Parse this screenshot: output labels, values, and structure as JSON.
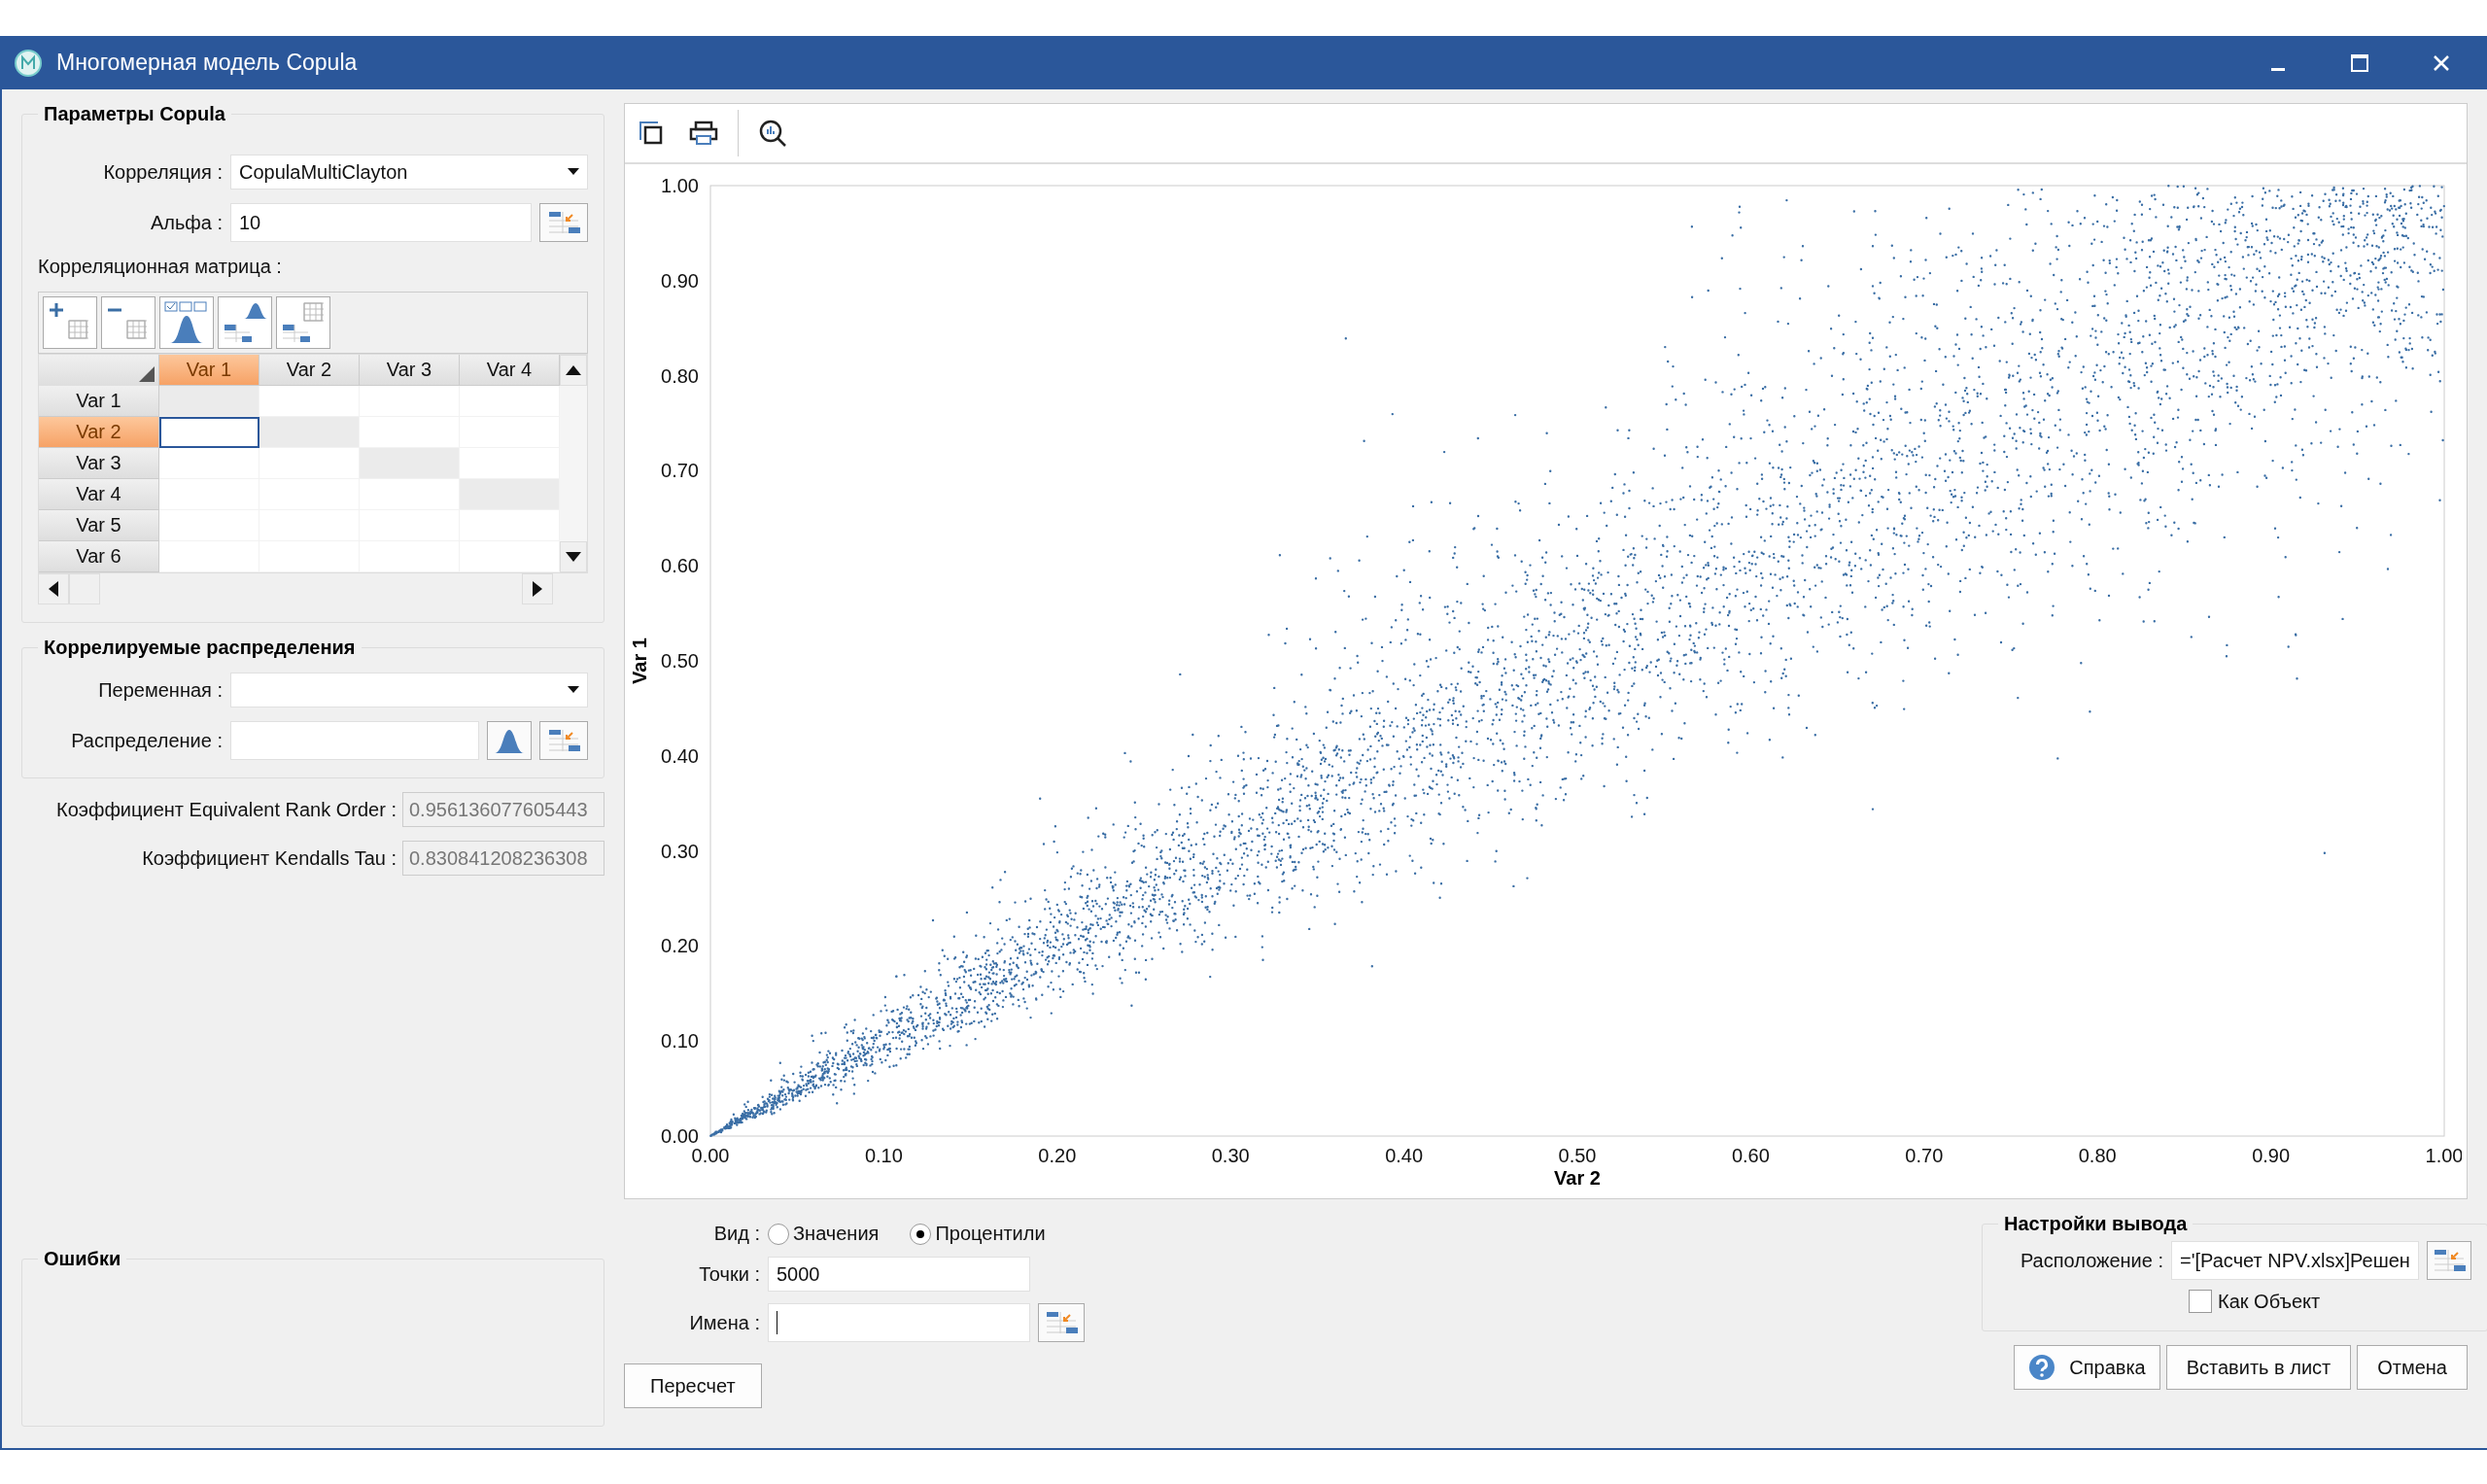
{
  "window": {
    "title": "Многомерная модель Copula"
  },
  "copula_params": {
    "title": "Параметры Copula",
    "correlation": {
      "label": "Корреляция :",
      "value": "CopulaMultiClayton"
    },
    "alpha": {
      "label": "Альфа :",
      "value": "10"
    },
    "matrix_label": "Корреляционная матрица :",
    "matrix": {
      "columns": [
        {
          "label": "Var 1",
          "selected": true
        },
        {
          "label": "Var 2",
          "selected": false
        },
        {
          "label": "Var 3",
          "selected": false
        },
        {
          "label": "Var 4",
          "selected": false
        }
      ],
      "rows": [
        {
          "label": "Var 1",
          "selected": false
        },
        {
          "label": "Var 2",
          "selected": true
        },
        {
          "label": "Var 3",
          "selected": false
        },
        {
          "label": "Var 4",
          "selected": false
        },
        {
          "label": "Var 5",
          "selected": false
        },
        {
          "label": "Var 6",
          "selected": false
        }
      ]
    }
  },
  "distributions": {
    "title": "Коррелируемые распределения",
    "variable": {
      "label": "Переменная :"
    },
    "distribution": {
      "label": "Распределение :"
    }
  },
  "coefficients": [
    {
      "label": "Коэффициент Equivalent Rank Order :",
      "value": "0.956136077605443"
    },
    {
      "label": "Коэффициент Kendalls Tau :",
      "value": "0.830841208236308"
    }
  ],
  "errors": {
    "title": "Ошибки"
  },
  "chart": {
    "chart_data": {
      "type": "scatter",
      "xlabel": "Var 2",
      "ylabel": "Var 1",
      "xlim": [
        0,
        1
      ],
      "ylim": [
        0,
        1
      ],
      "xticks": [
        {
          "value": 0,
          "label": "0.00"
        },
        {
          "value": 0.1,
          "label": "0.10"
        },
        {
          "value": 0.2,
          "label": "0.20"
        },
        {
          "value": 0.3,
          "label": "0.30"
        },
        {
          "value": 0.4,
          "label": "0.40"
        },
        {
          "value": 0.5,
          "label": "0.50"
        },
        {
          "value": 0.6,
          "label": "0.60"
        },
        {
          "value": 0.7,
          "label": "0.70"
        },
        {
          "value": 0.8,
          "label": "0.80"
        },
        {
          "value": 0.9,
          "label": "0.90"
        },
        {
          "value": 1,
          "label": "1.00"
        }
      ],
      "yticks": [
        {
          "value": 0,
          "label": "0.00"
        },
        {
          "value": 0.1,
          "label": "0.10"
        },
        {
          "value": 0.2,
          "label": "0.20"
        },
        {
          "value": 0.3,
          "label": "0.30"
        },
        {
          "value": 0.4,
          "label": "0.40"
        },
        {
          "value": 0.5,
          "label": "0.50"
        },
        {
          "value": 0.6,
          "label": "0.60"
        },
        {
          "value": 0.7,
          "label": "0.70"
        },
        {
          "value": 0.8,
          "label": "0.80"
        },
        {
          "value": 0.9,
          "label": "0.90"
        },
        {
          "value": 1,
          "label": "1.00"
        }
      ]
    }
  },
  "view": {
    "label": "Вид :",
    "options": [
      {
        "label": "Значения",
        "selected": false
      },
      {
        "label": "Процентили",
        "selected": true
      }
    ]
  },
  "points": {
    "label": "Точки :",
    "value": "5000"
  },
  "names": {
    "label": "Имена :"
  },
  "recalc_button": "Пересчет",
  "output": {
    "title": "Настройки вывода",
    "location": {
      "label": "Расположение :",
      "value": "='[Расчет NPV.xlsx]Решен"
    },
    "as_object": {
      "label": "Как Объект",
      "checked": false
    }
  },
  "buttons": [
    {
      "kind": "help",
      "label": "Справка"
    },
    {
      "kind": "plain",
      "label": "Вставить в лист"
    },
    {
      "kind": "plain",
      "label": "Отмена"
    }
  ]
}
